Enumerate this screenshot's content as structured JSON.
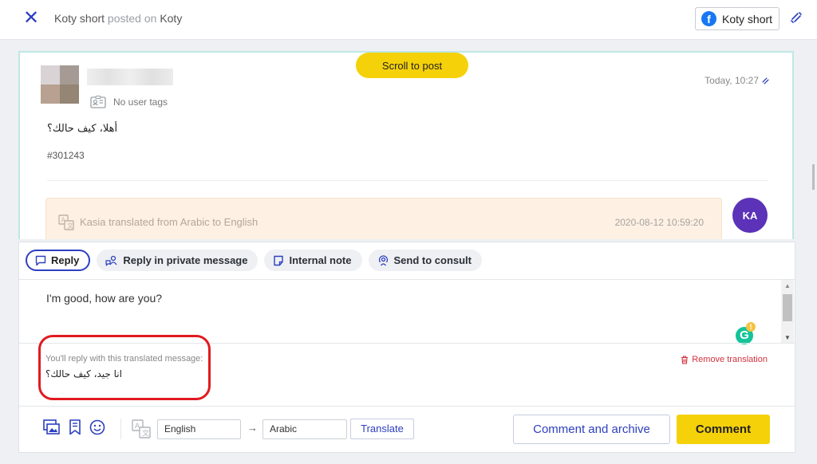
{
  "header": {
    "author": "Koty short",
    "posted_on_text": "posted on",
    "page_name": "Koty",
    "channel_label": "Koty short"
  },
  "post": {
    "scroll_button": "Scroll to post",
    "user_tags": "No user tags",
    "time": "Today, 10:27",
    "message": "أهلا، كيف حالك؟",
    "message_id": "#301243",
    "translation_note": "Kasia translated from Arabic to English",
    "translation_date": "2020-08-12 10:59:20",
    "agent_initials": "KA"
  },
  "reply": {
    "tabs": [
      {
        "label": "Reply"
      },
      {
        "label": "Reply in private message"
      },
      {
        "label": "Internal note"
      },
      {
        "label": "Send to consult"
      }
    ],
    "input_text": "I'm good, how are you?",
    "translated_label": "You'll reply with this translated message:",
    "translated_text": "انا جيد، كيف حالك؟",
    "remove_translation": "Remove translation",
    "source_language": "English",
    "target_language": "Arabic",
    "translate_button": "Translate",
    "archive_button": "Comment and archive",
    "comment_button": "Comment"
  },
  "colors": {
    "accent": "#2d3fbf",
    "primary_button": "#f5d10a",
    "facebook": "#1877f2",
    "danger": "#d1323d",
    "avatar_agent": "#5b32b8"
  }
}
